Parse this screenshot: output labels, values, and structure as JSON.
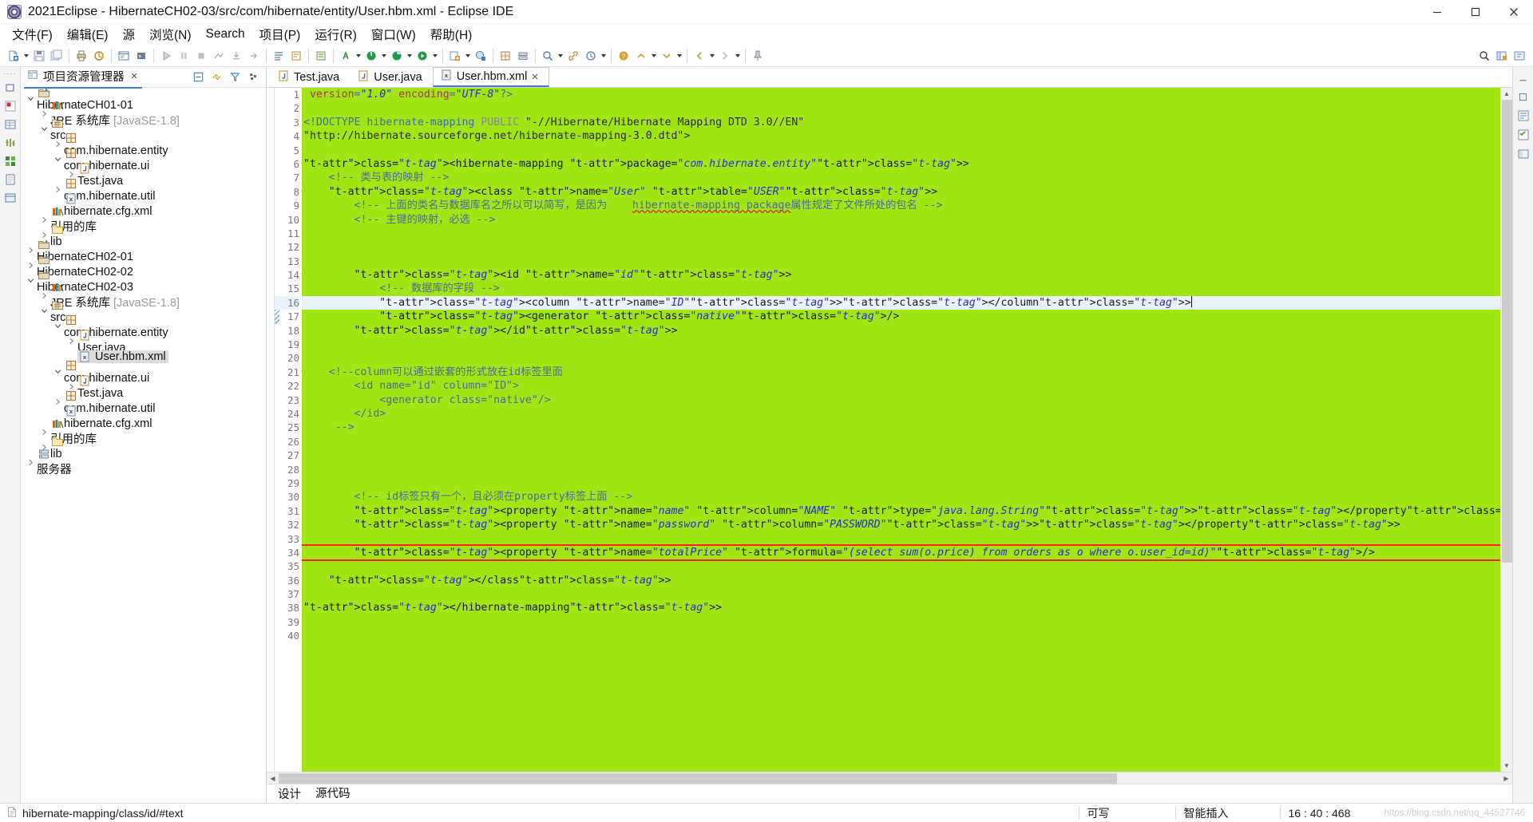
{
  "window": {
    "title": "2021Eclipse - HibernateCH02-03/src/com/hibernate/entity/User.hbm.xml - Eclipse IDE",
    "app_icon": "eclipse-icon",
    "minimize_label": "Minimize",
    "maximize_label": "Maximize",
    "close_label": "Close"
  },
  "menubar": {
    "items": [
      {
        "label": "文件(F)",
        "accel": "F"
      },
      {
        "label": "编辑(E)",
        "accel": "E"
      },
      {
        "label": "源",
        "accel": ""
      },
      {
        "label": "浏览(N)",
        "accel": "N"
      },
      {
        "label": "Search",
        "accel": "a"
      },
      {
        "label": "项目(P)",
        "accel": "P"
      },
      {
        "label": "运行(R)",
        "accel": "R"
      },
      {
        "label": "窗口(W)",
        "accel": "W"
      },
      {
        "label": "帮助(H)",
        "accel": "H"
      }
    ]
  },
  "explorer": {
    "tab_label": "项目资源管理器",
    "tab_close": "✕",
    "tools": [
      "collapse-all-icon",
      "link-with-editor-icon",
      "filter-icon",
      "view-menu-icon"
    ],
    "tree": [
      {
        "indent": 0,
        "arrow": "v",
        "icon": "project-icon",
        "label": "HibernateCH01-01",
        "dim": ""
      },
      {
        "indent": 1,
        "arrow": ">",
        "icon": "library-icon",
        "label": "JRE 系统库",
        "dim": "[JavaSE-1.8]"
      },
      {
        "indent": 1,
        "arrow": "v",
        "icon": "srcfolder-icon",
        "label": "src",
        "dim": ""
      },
      {
        "indent": 2,
        "arrow": ">",
        "icon": "package-icon",
        "label": "com.hibernate.entity",
        "dim": ""
      },
      {
        "indent": 2,
        "arrow": "v",
        "icon": "package-icon",
        "label": "com.hibernate.ui",
        "dim": ""
      },
      {
        "indent": 3,
        "arrow": ">",
        "icon": "java-file-icon",
        "label": "Test.java",
        "dim": ""
      },
      {
        "indent": 2,
        "arrow": ">",
        "icon": "package-icon",
        "label": "com.hibernate.util",
        "dim": ""
      },
      {
        "indent": 2,
        "arrow": "",
        "icon": "xml-file-icon",
        "label": "hibernate.cfg.xml",
        "dim": ""
      },
      {
        "indent": 1,
        "arrow": ">",
        "icon": "library-icon",
        "label": "引用的库",
        "dim": ""
      },
      {
        "indent": 1,
        "arrow": ">",
        "icon": "folder-icon",
        "label": "lib",
        "dim": ""
      },
      {
        "indent": 0,
        "arrow": ">",
        "icon": "project-icon",
        "label": "HibernateCH02-01",
        "dim": ""
      },
      {
        "indent": 0,
        "arrow": ">",
        "icon": "project-icon",
        "label": "HibernateCH02-02",
        "dim": ""
      },
      {
        "indent": 0,
        "arrow": "v",
        "icon": "project-icon",
        "label": "HibernateCH02-03",
        "dim": ""
      },
      {
        "indent": 1,
        "arrow": ">",
        "icon": "library-icon",
        "label": "JRE 系统库",
        "dim": "[JavaSE-1.8]"
      },
      {
        "indent": 1,
        "arrow": "v",
        "icon": "srcfolder-icon",
        "label": "src",
        "dim": ""
      },
      {
        "indent": 2,
        "arrow": "v",
        "icon": "package-icon",
        "label": "com.hibernate.entity",
        "dim": ""
      },
      {
        "indent": 3,
        "arrow": ">",
        "icon": "java-file-icon",
        "label": "User.java",
        "dim": ""
      },
      {
        "indent": 3,
        "arrow": "",
        "icon": "xml-file-icon",
        "label": "User.hbm.xml",
        "dim": "",
        "selected": true
      },
      {
        "indent": 2,
        "arrow": "v",
        "icon": "package-icon",
        "label": "com.hibernate.ui",
        "dim": ""
      },
      {
        "indent": 3,
        "arrow": ">",
        "icon": "java-file-icon",
        "label": "Test.java",
        "dim": ""
      },
      {
        "indent": 2,
        "arrow": ">",
        "icon": "package-icon",
        "label": "com.hibernate.util",
        "dim": ""
      },
      {
        "indent": 2,
        "arrow": "",
        "icon": "xml-file-icon",
        "label": "hibernate.cfg.xml",
        "dim": ""
      },
      {
        "indent": 1,
        "arrow": ">",
        "icon": "library-icon",
        "label": "引用的库",
        "dim": ""
      },
      {
        "indent": 1,
        "arrow": ">",
        "icon": "folder-icon",
        "label": "lib",
        "dim": ""
      },
      {
        "indent": 0,
        "arrow": ">",
        "icon": "server-icon",
        "label": "服务器",
        "dim": ""
      }
    ]
  },
  "editor": {
    "tabs": [
      {
        "label": "Test.java",
        "icon": "java-file-icon",
        "active": false,
        "close": ""
      },
      {
        "label": "User.java",
        "icon": "java-file-icon",
        "active": false,
        "close": ""
      },
      {
        "label": "User.hbm.xml",
        "icon": "xml-file-icon",
        "active": true,
        "close": "✕"
      }
    ],
    "bottom_tabs": [
      {
        "label": "设计",
        "active": false
      },
      {
        "label": "源代码",
        "active": true
      }
    ],
    "background_color": "#a2e515",
    "current_line": 16,
    "boxed_line": 34,
    "highlight_box_color": "#ff1f1f",
    "lines": [
      {
        "n": 1,
        "fold": "",
        "text": "<?xml version=\"1.0\" encoding=\"UTF-8\"?>"
      },
      {
        "n": 2,
        "fold": "",
        "text": ""
      },
      {
        "n": 3,
        "fold": "",
        "text": "<!DOCTYPE hibernate-mapping PUBLIC \"-//Hibernate/Hibernate Mapping DTD 3.0//EN\""
      },
      {
        "n": 4,
        "fold": "",
        "text": "\"http://hibernate.sourceforge.net/hibernate-mapping-3.0.dtd\">"
      },
      {
        "n": 5,
        "fold": "",
        "text": ""
      },
      {
        "n": 6,
        "fold": "⊖",
        "text": "<hibernate-mapping package=\"com.hibernate.entity\">"
      },
      {
        "n": 7,
        "fold": "",
        "text": "    <!-- 类与表的映射 -->"
      },
      {
        "n": 8,
        "fold": "⊖",
        "text": "    <class name=\"User\" table=\"USER\">"
      },
      {
        "n": 9,
        "fold": "",
        "text": "        <!-- 上面的类名与数据库名之所以可以简写，是因为    hibernate-mapping package属性规定了文件所处的包名 -->"
      },
      {
        "n": 10,
        "fold": "",
        "text": "        <!-- 主键的映射，必选 -->"
      },
      {
        "n": 11,
        "fold": "",
        "text": ""
      },
      {
        "n": 12,
        "fold": "",
        "text": ""
      },
      {
        "n": 13,
        "fold": "",
        "text": ""
      },
      {
        "n": 14,
        "fold": "⊖",
        "text": "        <id name=\"id\">"
      },
      {
        "n": 15,
        "fold": "",
        "text": "            <!-- 数据库的字段 -->"
      },
      {
        "n": 16,
        "fold": "",
        "text": "            <column name=\"ID\"></column>"
      },
      {
        "n": 17,
        "fold": "",
        "text": "            <generator class=\"native\"/>"
      },
      {
        "n": 18,
        "fold": "",
        "text": "        </id>"
      },
      {
        "n": 19,
        "fold": "",
        "text": ""
      },
      {
        "n": 20,
        "fold": "",
        "text": ""
      },
      {
        "n": 21,
        "fold": "⊖",
        "text": "    <!--column可以通过嵌套的形式放在id标签里面"
      },
      {
        "n": 22,
        "fold": "",
        "text": "        <id name=\"id\" column=\"ID\">"
      },
      {
        "n": 23,
        "fold": "",
        "text": "            <generator class=\"native\"/>"
      },
      {
        "n": 24,
        "fold": "",
        "text": "        </id>"
      },
      {
        "n": 25,
        "fold": "",
        "text": "     -->"
      },
      {
        "n": 26,
        "fold": "",
        "text": ""
      },
      {
        "n": 27,
        "fold": "",
        "text": ""
      },
      {
        "n": 28,
        "fold": "",
        "text": ""
      },
      {
        "n": 29,
        "fold": "",
        "text": ""
      },
      {
        "n": 30,
        "fold": "",
        "text": "        <!-- id标签只有一个，且必须在property标签上面 -->"
      },
      {
        "n": 31,
        "fold": "",
        "text": "        <property name=\"name\" column=\"NAME\" type=\"java.lang.String\"></property>"
      },
      {
        "n": 32,
        "fold": "",
        "text": "        <property name=\"password\" column=\"PASSWORD\"></property>"
      },
      {
        "n": 33,
        "fold": "",
        "text": ""
      },
      {
        "n": 34,
        "fold": "",
        "text": "        <property name=\"totalPrice\" formula=\"(select sum(o.price) from orders as o where o.user_id=id)\"/>"
      },
      {
        "n": 35,
        "fold": "",
        "text": ""
      },
      {
        "n": 36,
        "fold": "",
        "text": "    </class>"
      },
      {
        "n": 37,
        "fold": "",
        "text": ""
      },
      {
        "n": 38,
        "fold": "",
        "text": "</hibernate-mapping>"
      },
      {
        "n": 39,
        "fold": "",
        "text": ""
      },
      {
        "n": 40,
        "fold": "",
        "text": ""
      }
    ]
  },
  "statusbar": {
    "icon": "doc-icon",
    "path": "hibernate-mapping/class/id/#text",
    "writable": "可写",
    "insert_mode": "智能插入",
    "position": "16 : 40 : 468",
    "watermark": "https://blog.csdn.net/qq_44527746"
  },
  "toolbar": {
    "buttons": [
      "new-icon",
      "save-icon",
      "save-all-icon",
      "print-icon",
      "build-icon",
      "validate-icon",
      "console-icon",
      "terminal-icon",
      "run-last-icon",
      "step-over-icon",
      "stop-icon",
      "relation-icon",
      "step-into-icon",
      "step-return-icon",
      "resume-icon",
      "outline-icon",
      "format-icon",
      "open-type-icon",
      "ant-icon",
      "coverage-icon",
      "debug-icon",
      "run-icon",
      "profile-icon",
      "new-java-project-icon",
      "new-class-icon",
      "new-package-icon",
      "server-icon",
      "search-icon",
      "link-icon",
      "history-icon",
      "help-icon",
      "prev-annotation-icon",
      "next-annotation-icon",
      "back-icon",
      "forward-icon",
      "pin-icon"
    ],
    "right_buttons": [
      "quick-access-search-icon",
      "open-perspective-icon",
      "java-perspective-icon"
    ]
  },
  "rail_left": [
    "restore-icon",
    "markers-icon",
    "properties-icon",
    "servers-icon",
    "data-source-icon",
    "snippets-icon",
    "console-view-icon"
  ],
  "rail_right": [
    "outline-view-icon",
    "task-list-icon",
    "palette-icon"
  ]
}
